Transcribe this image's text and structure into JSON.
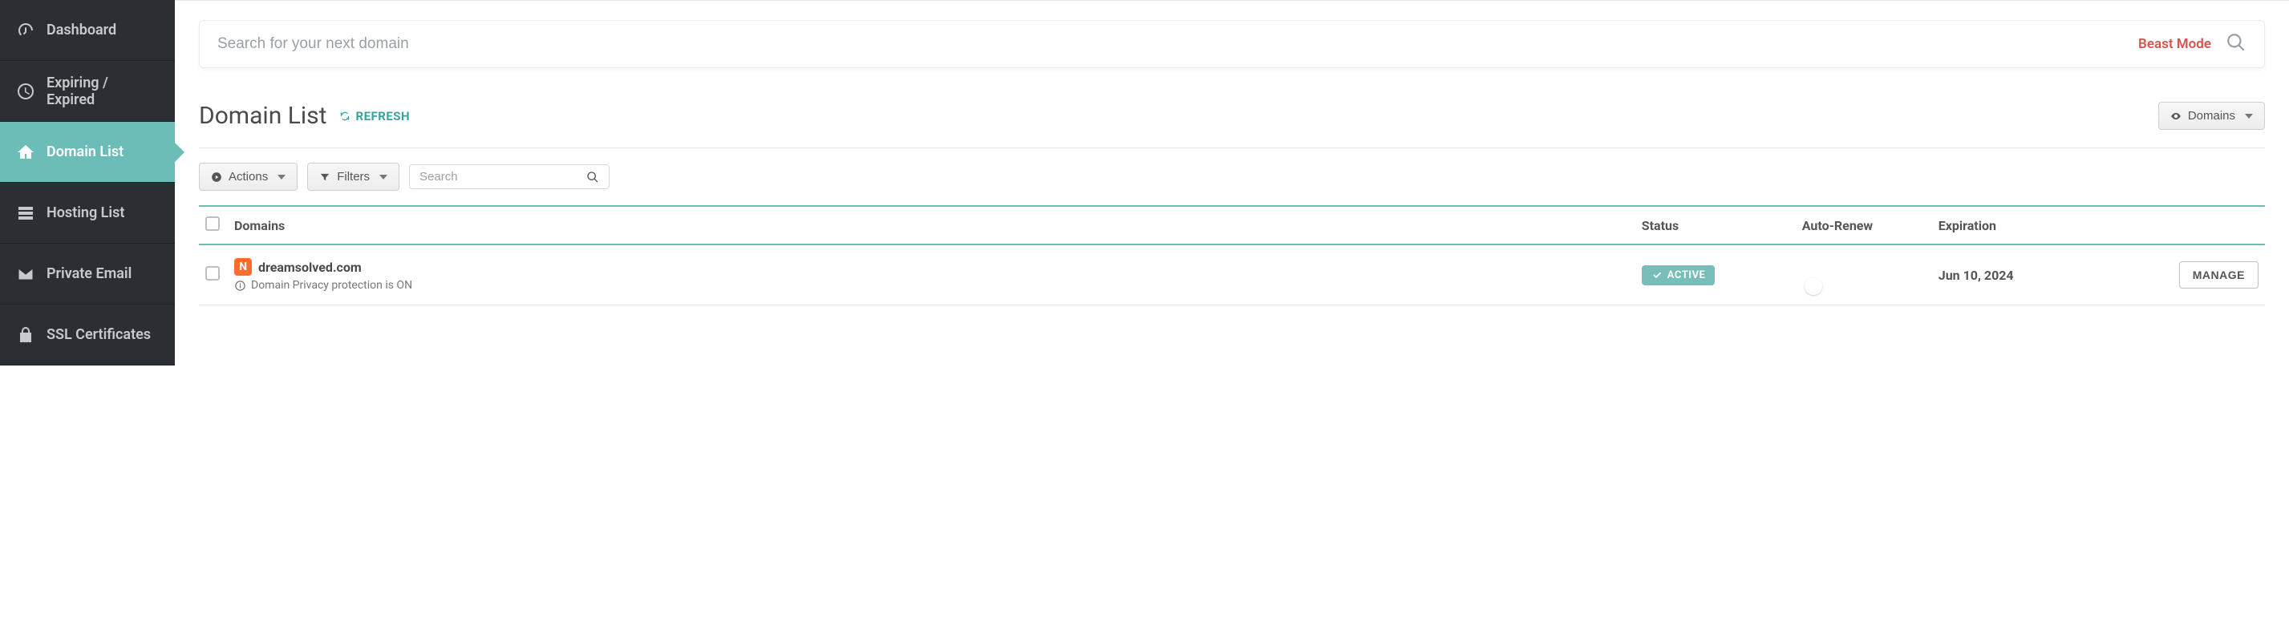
{
  "sidebar": {
    "items": [
      {
        "icon": "gauge-icon",
        "label": "Dashboard",
        "active": false
      },
      {
        "icon": "clock-icon",
        "label": "Expiring / Expired",
        "active": false
      },
      {
        "icon": "home-icon",
        "label": "Domain List",
        "active": true
      },
      {
        "icon": "server-icon",
        "label": "Hosting List",
        "active": false
      },
      {
        "icon": "mail-icon",
        "label": "Private Email",
        "active": false
      },
      {
        "icon": "lock-icon",
        "label": "SSL Certificates",
        "active": false
      }
    ]
  },
  "search": {
    "placeholder": "Search for your next domain",
    "beast_mode_label": "Beast Mode"
  },
  "header": {
    "title": "Domain List",
    "refresh_label": "REFRESH",
    "view_selector_label": "Domains"
  },
  "toolbar": {
    "actions_label": "Actions",
    "filters_label": "Filters",
    "search_placeholder": "Search"
  },
  "table": {
    "columns": {
      "domains": "Domains",
      "status": "Status",
      "auto_renew": "Auto-Renew",
      "expiration": "Expiration"
    },
    "rows": [
      {
        "domain": "dreamsolved.com",
        "privacy_note": "Domain Privacy protection is ON",
        "status_label": "ACTIVE",
        "auto_renew": false,
        "expiration": "Jun 10, 2024",
        "manage_label": "MANAGE"
      }
    ]
  }
}
